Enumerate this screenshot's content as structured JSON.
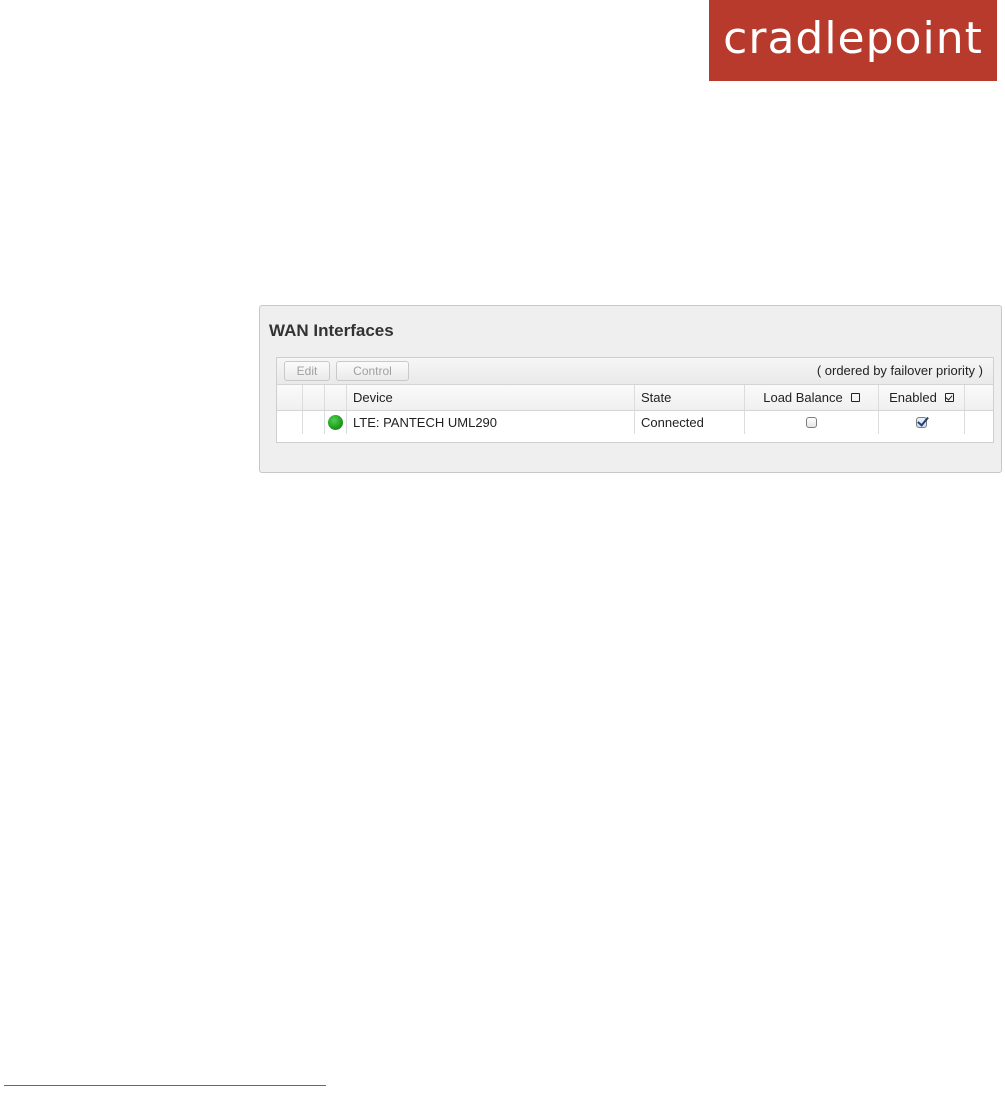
{
  "logo": {
    "text": "cradlepoint",
    "color": "#b83a2d"
  },
  "panel": {
    "title": "WAN Interfaces",
    "toolbar": {
      "edit_label": "Edit",
      "control_label": "Control",
      "note": "( ordered by failover priority )"
    },
    "columns": {
      "device": "Device",
      "state": "State",
      "load_balance": "Load Balance",
      "load_balance_all_checked": false,
      "enabled": "Enabled",
      "enabled_all_checked": true
    },
    "rows": [
      {
        "status_icon": "green-status-dot",
        "status_color": "#1f9a1f",
        "device": "LTE: PANTECH UML290",
        "state": "Connected",
        "load_balance": false,
        "enabled": true
      }
    ]
  }
}
